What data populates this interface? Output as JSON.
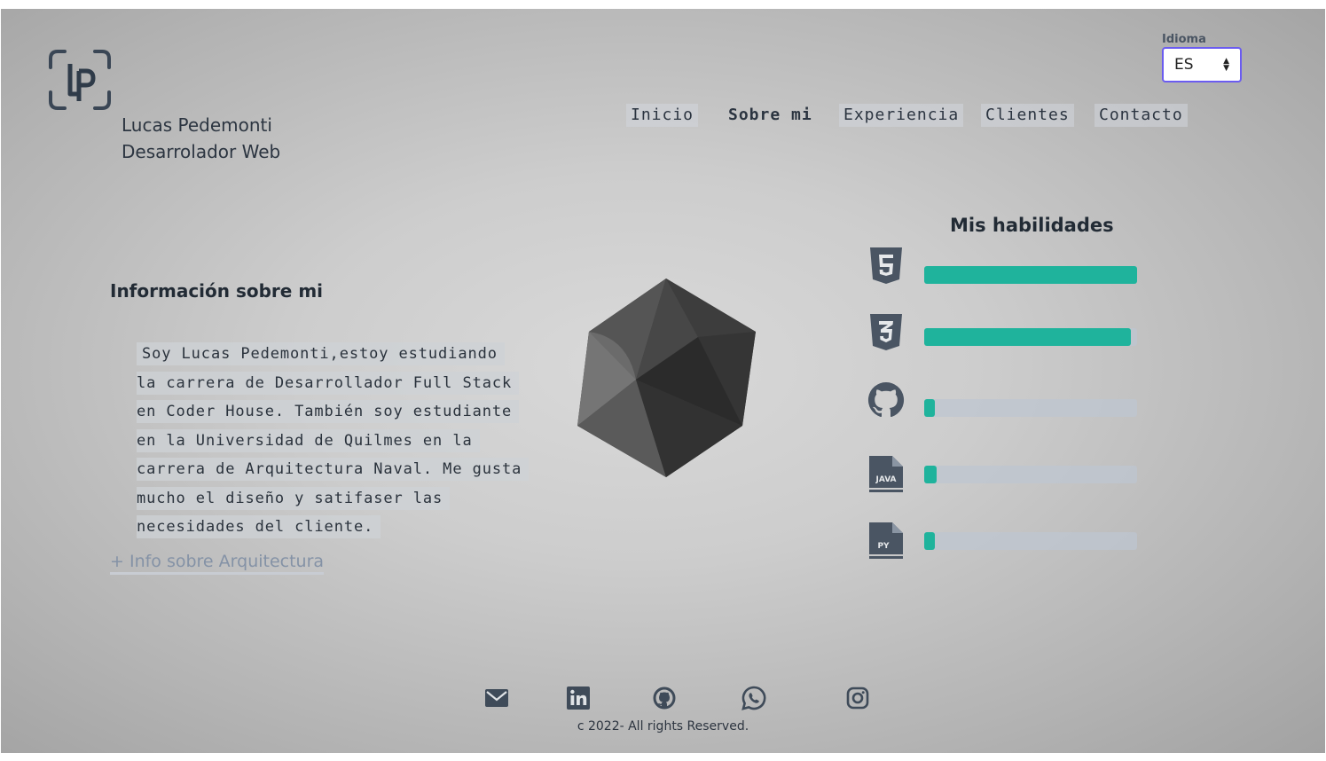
{
  "brand": {
    "name": "Lucas Pedemonti",
    "role": "Desarrolador Web"
  },
  "language": {
    "label": "Idioma",
    "selected": "ES"
  },
  "nav": [
    {
      "label": "Inicio",
      "active": false
    },
    {
      "label": "Sobre mi",
      "active": true
    },
    {
      "label": "Experiencia",
      "active": false
    },
    {
      "label": "Clientes",
      "active": false
    },
    {
      "label": "Contacto",
      "active": false
    }
  ],
  "about": {
    "title": "Información sobre mi",
    "lines": [
      "Soy Lucas Pedemonti,estoy estudiando",
      "la carrera de Desarrollador Full Stack",
      "en Coder House. También soy estudiante",
      "en la Universidad de Quilmes en la",
      "carrera de Arquitectura Naval. Me gusta",
      "mucho el diseño y satifaser las",
      "necesidades del cliente."
    ],
    "link": "+ Info sobre Arquitectura"
  },
  "skills": {
    "title": "Mis habilidades",
    "items": [
      {
        "icon": "html5-icon",
        "level": 1.0
      },
      {
        "icon": "css3-icon",
        "level": 0.97
      },
      {
        "icon": "github-icon",
        "level": 0.05
      },
      {
        "icon": "java-file-icon",
        "level": 0.06,
        "icon_text": "JAVA"
      },
      {
        "icon": "python-file-icon",
        "level": 0.05,
        "icon_text": "PY"
      }
    ],
    "bar_color": "#1fb39c"
  },
  "footer": {
    "social": [
      "mail-icon",
      "linkedin-icon",
      "github-icon",
      "whatsapp-icon",
      "instagram-icon"
    ],
    "copyright": "c 2022- All rights Reserved."
  }
}
